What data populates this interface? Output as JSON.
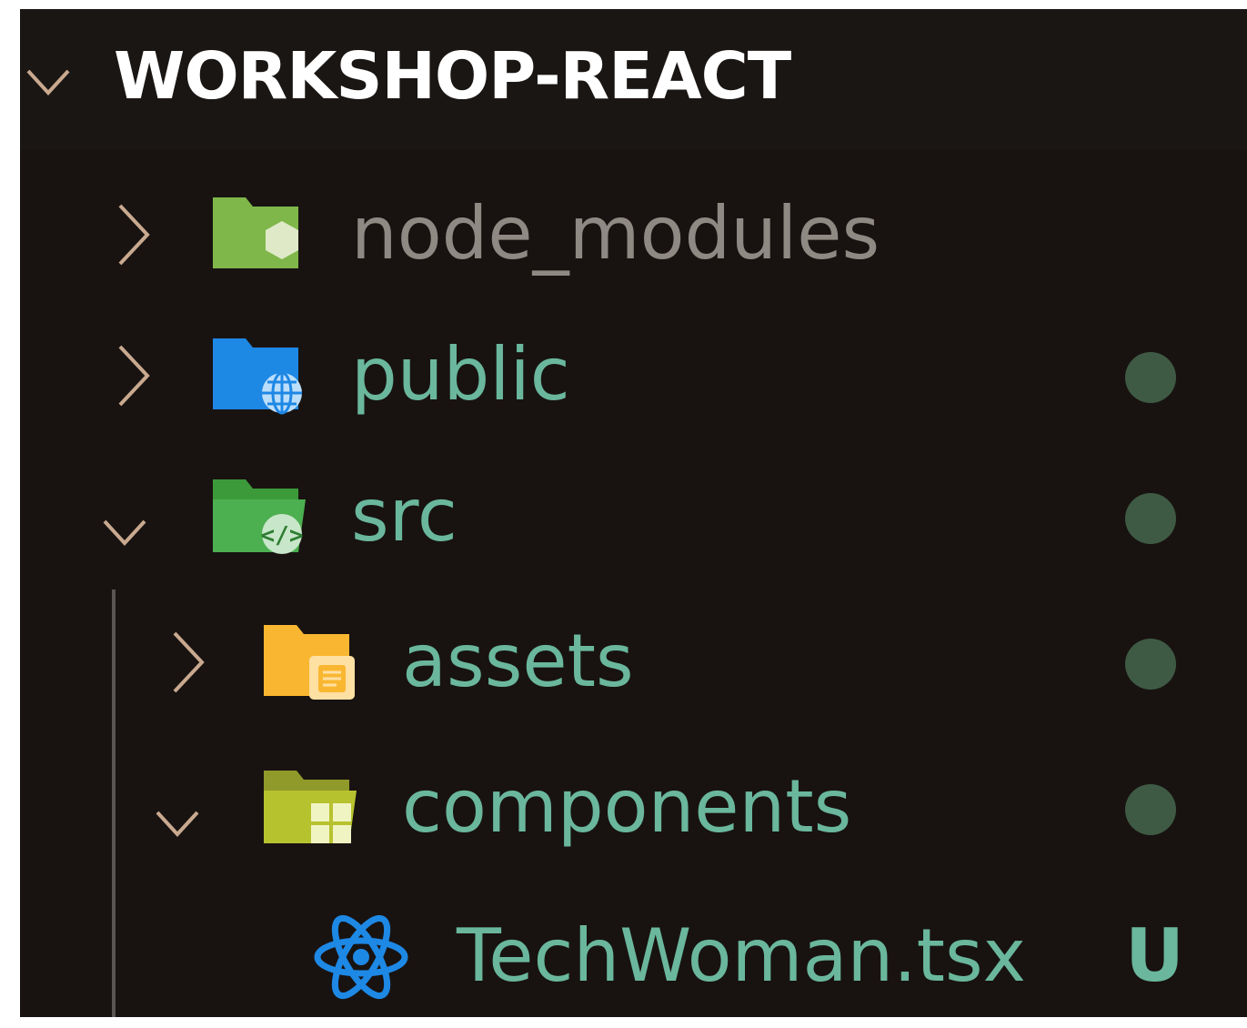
{
  "explorer": {
    "title": "WORKSHOP-REACT",
    "items": [
      {
        "label": "node_modules",
        "kind": "folder",
        "expanded": false,
        "icon": "node-folder-icon",
        "status": ""
      },
      {
        "label": "public",
        "kind": "folder",
        "expanded": false,
        "icon": "public-folder-icon",
        "status": "dot"
      },
      {
        "label": "src",
        "kind": "folder",
        "expanded": true,
        "icon": "src-folder-icon",
        "status": "dot"
      },
      {
        "label": "assets",
        "kind": "folder",
        "expanded": false,
        "icon": "assets-folder-icon",
        "status": "dot"
      },
      {
        "label": "components",
        "kind": "folder",
        "expanded": true,
        "icon": "components-folder-icon",
        "status": "dot"
      },
      {
        "label": "TechWoman.tsx",
        "kind": "file",
        "icon": "react-icon",
        "status": "U"
      }
    ]
  },
  "colors": {
    "background": "#181311",
    "header_background": "#1a1614",
    "header_text": "#ffffff",
    "modified_text": "#6ab79d",
    "ignored_text": "#8f8984",
    "status_dot": "#3e5a44",
    "chevron": "#c9a98f"
  }
}
